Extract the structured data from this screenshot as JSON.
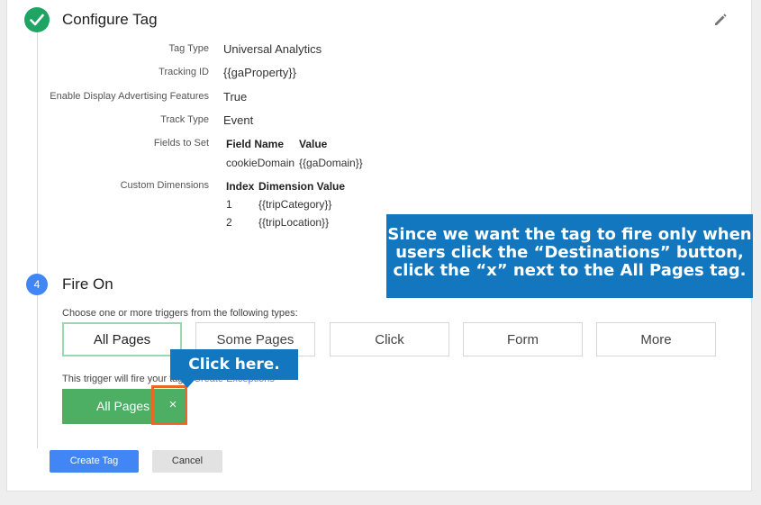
{
  "configure": {
    "title": "Configure Tag",
    "rows": [
      {
        "label": "Tag Type",
        "value": "Universal Analytics"
      },
      {
        "label": "Tracking ID",
        "value": "{{gaProperty}}"
      },
      {
        "label": "Enable Display Advertising Features",
        "value": "True"
      },
      {
        "label": "Track Type",
        "value": "Event"
      },
      {
        "label": "Fields to Set",
        "value": ""
      },
      {
        "label": "Custom Dimensions",
        "value": ""
      }
    ],
    "fields_table": {
      "headers": [
        "Field Name",
        "Value"
      ],
      "rows": [
        [
          "cookieDomain",
          "{{gaDomain}}"
        ]
      ]
    },
    "dimensions_table": {
      "headers": [
        "Index",
        "Dimension Value"
      ],
      "rows": [
        [
          "1",
          "{{tripCategory}}"
        ],
        [
          "2",
          "{{tripLocation}}"
        ]
      ]
    }
  },
  "fire_on": {
    "step_number": "4",
    "title": "Fire On",
    "choose_text": "Choose one or more triggers from the following types:",
    "trigger_types": [
      "All Pages",
      "Some Pages",
      "Click",
      "Form",
      "More"
    ],
    "fire_text": "This trigger will fire your tag",
    "exceptions_link": "Create Exceptions",
    "selected_trigger": "All Pages",
    "remove_symbol": "×"
  },
  "callouts": {
    "main": "Since we want the tag to fire only when users click the “Destinations” button, click the “x” next to the All Pages tag.",
    "click_here": "Click here."
  },
  "actions": {
    "create": "Create Tag",
    "cancel": "Cancel"
  },
  "colors": {
    "step_complete": "#1fa463",
    "step_active": "#4285f4",
    "chip": "#4caf64",
    "callout": "#1277bf",
    "highlight": "#e8682a"
  }
}
